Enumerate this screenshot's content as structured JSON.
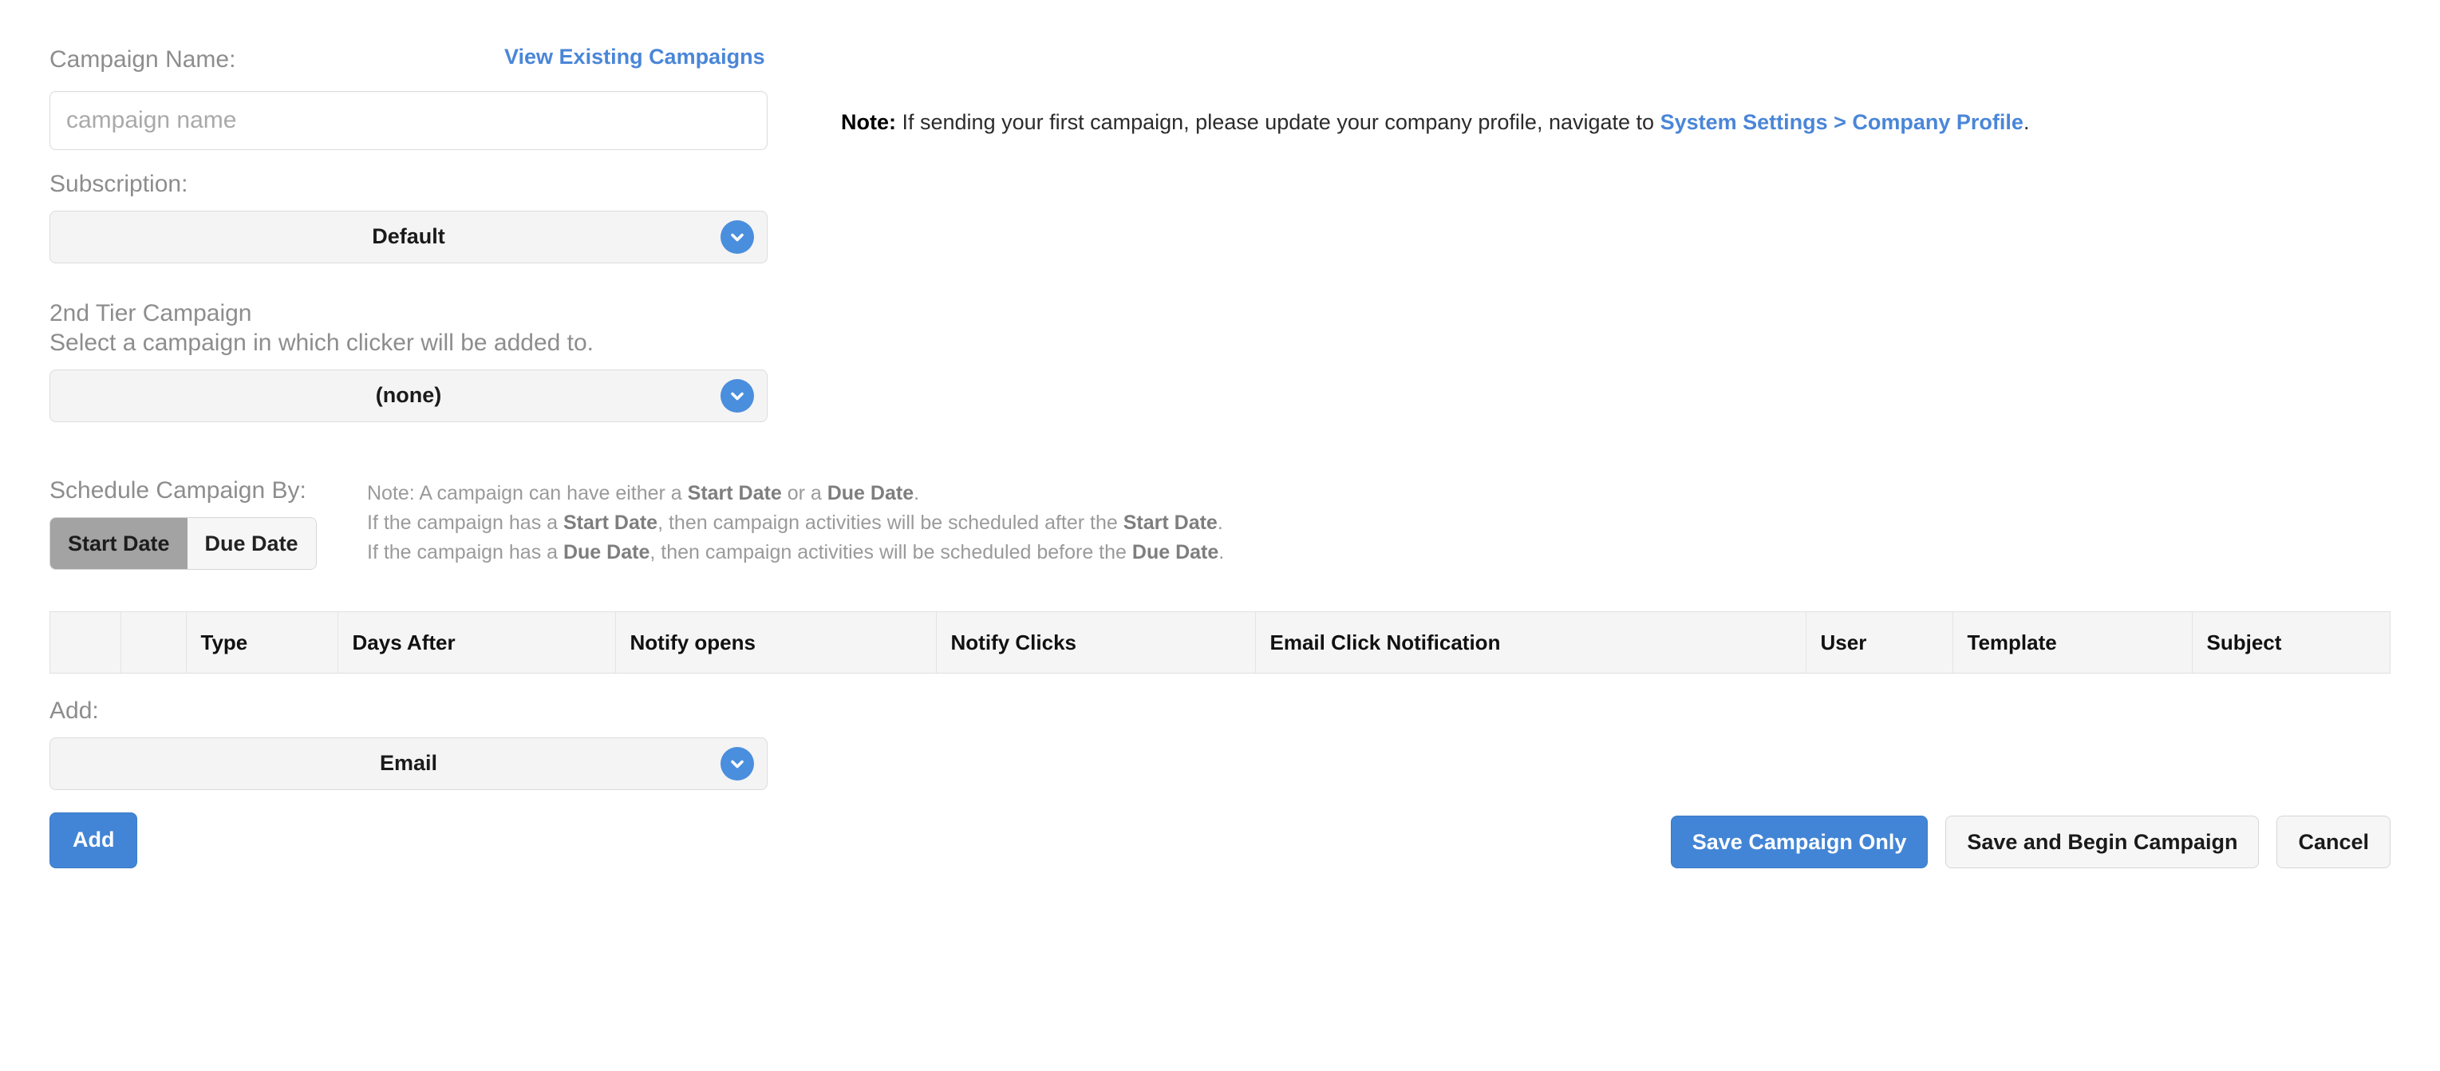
{
  "form": {
    "campaign_name_label": "Campaign Name:",
    "view_existing_link": "View Existing Campaigns",
    "campaign_name_placeholder": "campaign name",
    "campaign_name_value": "",
    "subscription_label": "Subscription:",
    "subscription_value": "Default",
    "second_tier_label": "2nd Tier Campaign",
    "second_tier_sublabel": "Select a campaign in which clicker will be added to.",
    "second_tier_value": "(none)",
    "schedule_label": "Schedule Campaign By:",
    "schedule_start_btn": "Start Date",
    "schedule_due_btn": "Due Date",
    "schedule_active": "Start Date",
    "add_label": "Add:",
    "add_value": "Email",
    "add_button": "Add"
  },
  "top_note": {
    "prefix": "Note:",
    "text_before_link": " If sending your first campaign, please update your company profile, navigate to ",
    "link": "System Settings > Company Profile",
    "text_after_link": "."
  },
  "schedule_note": {
    "line1_a": "Note: A campaign can have either a ",
    "line1_b": "Start Date",
    "line1_c": " or a ",
    "line1_d": "Due Date",
    "line1_e": ".",
    "line2_a": "If the campaign has a ",
    "line2_b": "Start Date",
    "line2_c": ", then campaign activities will be scheduled after the ",
    "line2_d": "Start Date",
    "line2_e": ".",
    "line3_a": "If the campaign has a ",
    "line3_b": "Due Date",
    "line3_c": ", then campaign activities will be scheduled before the ",
    "line3_d": "Due Date",
    "line3_e": "."
  },
  "table": {
    "columns": [
      "",
      "",
      "Type",
      "Days After",
      "Notify opens",
      "Notify Clicks",
      "Email Click Notification",
      "User",
      "Template",
      "Subject"
    ],
    "rows": []
  },
  "footer": {
    "save_campaign_only": "Save Campaign Only",
    "save_and_begin": "Save and Begin Campaign",
    "cancel": "Cancel"
  },
  "colors": {
    "accent_blue": "#4285d6",
    "chevron_blue": "#4a8ede",
    "link_blue": "#4a86d8",
    "label_gray": "#8d8d8d",
    "toggle_active_gray": "#a3a3a3",
    "panel_gray": "#f5f5f5",
    "border_gray": "#dcdcdc"
  }
}
